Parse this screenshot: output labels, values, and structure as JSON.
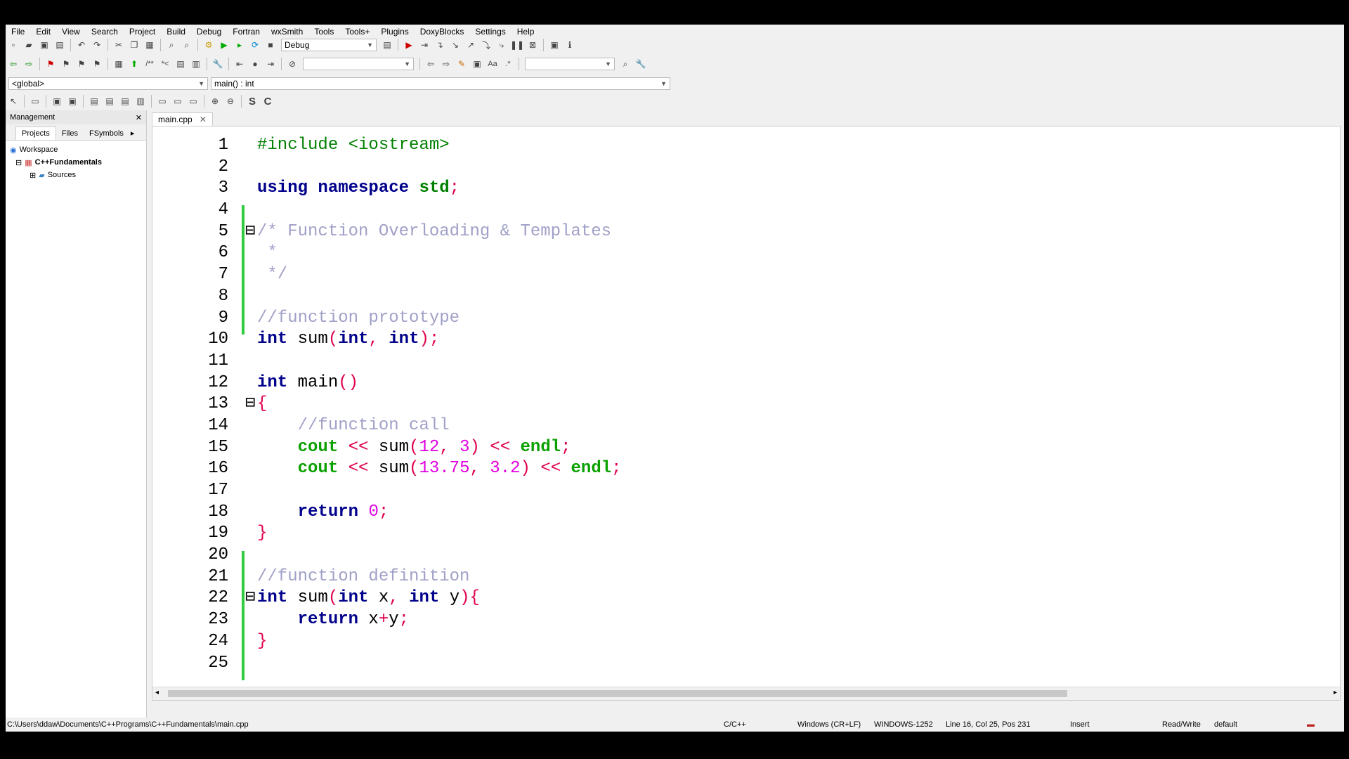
{
  "menu": [
    "File",
    "Edit",
    "View",
    "Search",
    "Project",
    "Build",
    "Debug",
    "Fortran",
    "wxSmith",
    "Tools",
    "Tools+",
    "Plugins",
    "DoxyBlocks",
    "Settings",
    "Help"
  ],
  "toolbar": {
    "build_target": "Debug",
    "scope": "<global>",
    "function": "main() : int"
  },
  "management": {
    "title": "Management",
    "tabs": [
      "Projects",
      "Files",
      "FSymbols"
    ],
    "tree": {
      "workspace": "Workspace",
      "project": "C++Fundamentals",
      "sources": "Sources"
    }
  },
  "editor": {
    "tab": "main.cpp",
    "lines": [
      "#include <iostream>",
      "",
      "using namespace std;",
      "",
      "/* Function Overloading & Templates",
      " *",
      " */",
      "",
      "//function prototype",
      "int sum(int, int);",
      "",
      "int main()",
      "{",
      "    //function call",
      "    cout << sum(12, 3) << endl;",
      "    cout << sum(13.75, 3.2) << endl;",
      "",
      "    return 0;",
      "}",
      "",
      "//function definition",
      "int sum(int x, int y){",
      "    return x+y;",
      "}",
      ""
    ]
  },
  "status": {
    "path": "C:\\Users\\ddaw\\Documents\\C++Programs\\C++Fundamentals\\main.cpp",
    "lang": "C/C++",
    "eol": "Windows (CR+LF)",
    "encoding": "WINDOWS-1252",
    "position": "Line 16, Col 25, Pos 231",
    "mode": "Insert",
    "access": "Read/Write",
    "theme": "default"
  }
}
